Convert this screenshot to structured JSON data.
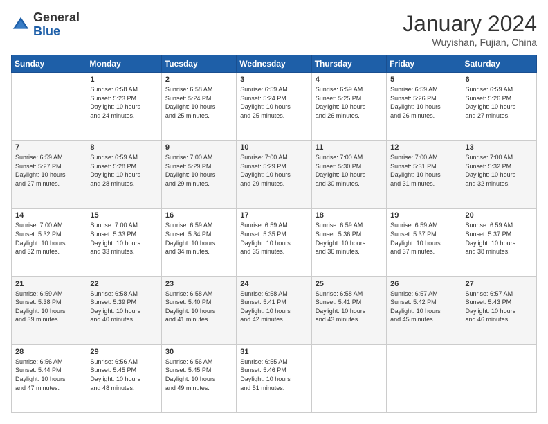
{
  "header": {
    "logo_general": "General",
    "logo_blue": "Blue",
    "month_title": "January 2024",
    "subtitle": "Wuyishan, Fujian, China"
  },
  "days_of_week": [
    "Sunday",
    "Monday",
    "Tuesday",
    "Wednesday",
    "Thursday",
    "Friday",
    "Saturday"
  ],
  "weeks": [
    [
      {
        "day": "",
        "info": ""
      },
      {
        "day": "1",
        "info": "Sunrise: 6:58 AM\nSunset: 5:23 PM\nDaylight: 10 hours\nand 24 minutes."
      },
      {
        "day": "2",
        "info": "Sunrise: 6:58 AM\nSunset: 5:24 PM\nDaylight: 10 hours\nand 25 minutes."
      },
      {
        "day": "3",
        "info": "Sunrise: 6:59 AM\nSunset: 5:24 PM\nDaylight: 10 hours\nand 25 minutes."
      },
      {
        "day": "4",
        "info": "Sunrise: 6:59 AM\nSunset: 5:25 PM\nDaylight: 10 hours\nand 26 minutes."
      },
      {
        "day": "5",
        "info": "Sunrise: 6:59 AM\nSunset: 5:26 PM\nDaylight: 10 hours\nand 26 minutes."
      },
      {
        "day": "6",
        "info": "Sunrise: 6:59 AM\nSunset: 5:26 PM\nDaylight: 10 hours\nand 27 minutes."
      }
    ],
    [
      {
        "day": "7",
        "info": "Sunrise: 6:59 AM\nSunset: 5:27 PM\nDaylight: 10 hours\nand 27 minutes."
      },
      {
        "day": "8",
        "info": "Sunrise: 6:59 AM\nSunset: 5:28 PM\nDaylight: 10 hours\nand 28 minutes."
      },
      {
        "day": "9",
        "info": "Sunrise: 7:00 AM\nSunset: 5:29 PM\nDaylight: 10 hours\nand 29 minutes."
      },
      {
        "day": "10",
        "info": "Sunrise: 7:00 AM\nSunset: 5:29 PM\nDaylight: 10 hours\nand 29 minutes."
      },
      {
        "day": "11",
        "info": "Sunrise: 7:00 AM\nSunset: 5:30 PM\nDaylight: 10 hours\nand 30 minutes."
      },
      {
        "day": "12",
        "info": "Sunrise: 7:00 AM\nSunset: 5:31 PM\nDaylight: 10 hours\nand 31 minutes."
      },
      {
        "day": "13",
        "info": "Sunrise: 7:00 AM\nSunset: 5:32 PM\nDaylight: 10 hours\nand 32 minutes."
      }
    ],
    [
      {
        "day": "14",
        "info": "Sunrise: 7:00 AM\nSunset: 5:32 PM\nDaylight: 10 hours\nand 32 minutes."
      },
      {
        "day": "15",
        "info": "Sunrise: 7:00 AM\nSunset: 5:33 PM\nDaylight: 10 hours\nand 33 minutes."
      },
      {
        "day": "16",
        "info": "Sunrise: 6:59 AM\nSunset: 5:34 PM\nDaylight: 10 hours\nand 34 minutes."
      },
      {
        "day": "17",
        "info": "Sunrise: 6:59 AM\nSunset: 5:35 PM\nDaylight: 10 hours\nand 35 minutes."
      },
      {
        "day": "18",
        "info": "Sunrise: 6:59 AM\nSunset: 5:36 PM\nDaylight: 10 hours\nand 36 minutes."
      },
      {
        "day": "19",
        "info": "Sunrise: 6:59 AM\nSunset: 5:37 PM\nDaylight: 10 hours\nand 37 minutes."
      },
      {
        "day": "20",
        "info": "Sunrise: 6:59 AM\nSunset: 5:37 PM\nDaylight: 10 hours\nand 38 minutes."
      }
    ],
    [
      {
        "day": "21",
        "info": "Sunrise: 6:59 AM\nSunset: 5:38 PM\nDaylight: 10 hours\nand 39 minutes."
      },
      {
        "day": "22",
        "info": "Sunrise: 6:58 AM\nSunset: 5:39 PM\nDaylight: 10 hours\nand 40 minutes."
      },
      {
        "day": "23",
        "info": "Sunrise: 6:58 AM\nSunset: 5:40 PM\nDaylight: 10 hours\nand 41 minutes."
      },
      {
        "day": "24",
        "info": "Sunrise: 6:58 AM\nSunset: 5:41 PM\nDaylight: 10 hours\nand 42 minutes."
      },
      {
        "day": "25",
        "info": "Sunrise: 6:58 AM\nSunset: 5:41 PM\nDaylight: 10 hours\nand 43 minutes."
      },
      {
        "day": "26",
        "info": "Sunrise: 6:57 AM\nSunset: 5:42 PM\nDaylight: 10 hours\nand 45 minutes."
      },
      {
        "day": "27",
        "info": "Sunrise: 6:57 AM\nSunset: 5:43 PM\nDaylight: 10 hours\nand 46 minutes."
      }
    ],
    [
      {
        "day": "28",
        "info": "Sunrise: 6:56 AM\nSunset: 5:44 PM\nDaylight: 10 hours\nand 47 minutes."
      },
      {
        "day": "29",
        "info": "Sunrise: 6:56 AM\nSunset: 5:45 PM\nDaylight: 10 hours\nand 48 minutes."
      },
      {
        "day": "30",
        "info": "Sunrise: 6:56 AM\nSunset: 5:45 PM\nDaylight: 10 hours\nand 49 minutes."
      },
      {
        "day": "31",
        "info": "Sunrise: 6:55 AM\nSunset: 5:46 PM\nDaylight: 10 hours\nand 51 minutes."
      },
      {
        "day": "",
        "info": ""
      },
      {
        "day": "",
        "info": ""
      },
      {
        "day": "",
        "info": ""
      }
    ]
  ]
}
